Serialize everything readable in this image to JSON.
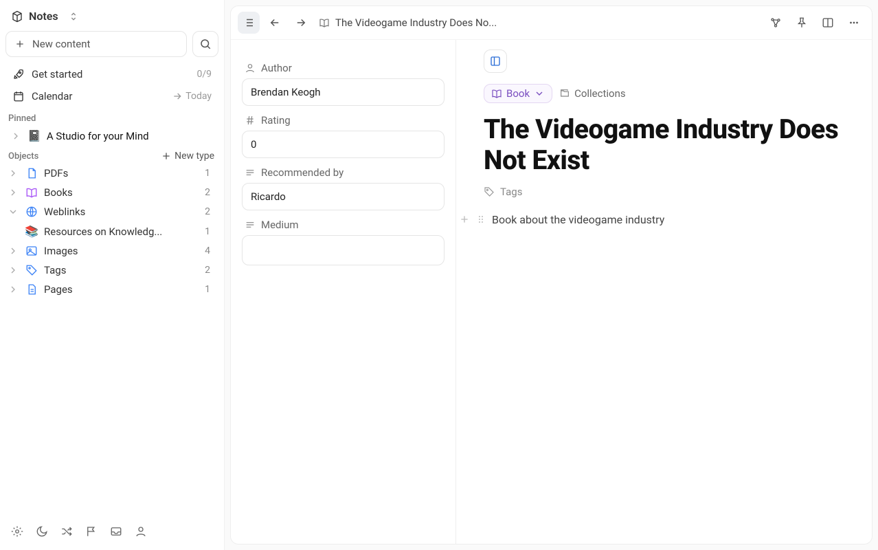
{
  "sidebar": {
    "workspace": "Notes",
    "new_content": "New content",
    "get_started": {
      "label": "Get started",
      "progress": "0/9"
    },
    "calendar": {
      "label": "Calendar",
      "right": "Today"
    },
    "pinned_label": "Pinned",
    "pinned_item": "A Studio for your Mind",
    "objects_label": "Objects",
    "new_type": "New type",
    "items": {
      "pdfs": {
        "label": "PDFs",
        "count": "1"
      },
      "books": {
        "label": "Books",
        "count": "2"
      },
      "weblinks": {
        "label": "Weblinks",
        "count": "2"
      },
      "weblink_child": {
        "label": "Resources on Knowledg...",
        "count": "1"
      },
      "images": {
        "label": "Images",
        "count": "4"
      },
      "tags": {
        "label": "Tags",
        "count": "2"
      },
      "pages": {
        "label": "Pages",
        "count": "1"
      }
    }
  },
  "topbar": {
    "crumb": "The Videogame Industry Does No..."
  },
  "props": {
    "author_label": "Author",
    "author_value": "Brendan Keogh",
    "rating_label": "Rating",
    "rating_value": "0",
    "recommended_label": "Recommended by",
    "recommended_value": "Ricardo",
    "medium_label": "Medium",
    "medium_value": ""
  },
  "doc": {
    "type_chip": "Book",
    "collections_chip": "Collections",
    "title": "The Videogame Industry Does Not Exist",
    "tags_label": "Tags",
    "paragraph": "Book about the videogame industry"
  }
}
